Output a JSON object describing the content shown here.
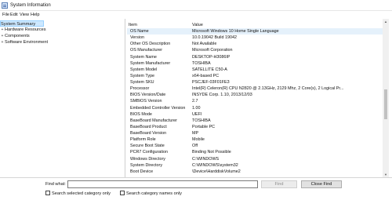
{
  "window": {
    "title": "System Information"
  },
  "menu": [
    "File",
    "Edit",
    "View",
    "Help"
  ],
  "tree": [
    {
      "label": "System Summary",
      "expander": "",
      "selected": true
    },
    {
      "label": "Hardware Resources",
      "expander": "+"
    },
    {
      "label": "Components",
      "expander": "+"
    },
    {
      "label": "Software Environment",
      "expander": "+"
    }
  ],
  "grid": {
    "columns": {
      "item": "Item",
      "value": "Value"
    },
    "rows": [
      {
        "item": "OS Name",
        "value": "Microsoft Windows 10 Home Single Language"
      },
      {
        "item": "Version",
        "value": "10.0.19042 Build 19042"
      },
      {
        "item": "Other OS Description",
        "value": "Not Available"
      },
      {
        "item": "OS Manufacturer",
        "value": "Microsoft Corporation"
      },
      {
        "item": "System Name",
        "value": "DESKTOP-H3086IP"
      },
      {
        "item": "System Manufacturer",
        "value": "TOSHIBA"
      },
      {
        "item": "System Model",
        "value": "SATELLITE C50-A"
      },
      {
        "item": "System Type",
        "value": "x64-based PC"
      },
      {
        "item": "System SKU",
        "value": "PSCJEF-03F01FE3"
      },
      {
        "item": "Processor",
        "value": "Intel(R) Celeron(R) CPU  N2820  @ 2.13GHz, 2129 Mhz, 2 Core(s), 2 Logical Pr..."
      },
      {
        "item": "BIOS Version/Date",
        "value": "INSYDE Corp. 1.10, 2013/12/03"
      },
      {
        "item": "SMBIOS Version",
        "value": "2.7"
      },
      {
        "item": "Embedded Controller Version",
        "value": "1.00"
      },
      {
        "item": "BIOS Mode",
        "value": "UEFI"
      },
      {
        "item": "BaseBoard Manufacturer",
        "value": "TOSHIBA"
      },
      {
        "item": "BaseBoard Product",
        "value": "Portable PC"
      },
      {
        "item": "BaseBoard Version",
        "value": "MP"
      },
      {
        "item": "Platform Role",
        "value": "Mobile"
      },
      {
        "item": "Secure Boot State",
        "value": "Off"
      },
      {
        "item": "PCR7 Configuration",
        "value": "Binding Not Possible"
      },
      {
        "item": "Windows Directory",
        "value": "C:\\WINDOWS"
      },
      {
        "item": "System Directory",
        "value": "C:\\WINDOWS\\system32"
      },
      {
        "item": "Boot Device",
        "value": "\\Device\\HarddiskVolume2"
      }
    ]
  },
  "find": {
    "label": "Find what:",
    "value": "",
    "find_button": "Find",
    "close_button": "Close Find",
    "search_selected": "Search selected category only",
    "search_names": "Search category names only"
  }
}
